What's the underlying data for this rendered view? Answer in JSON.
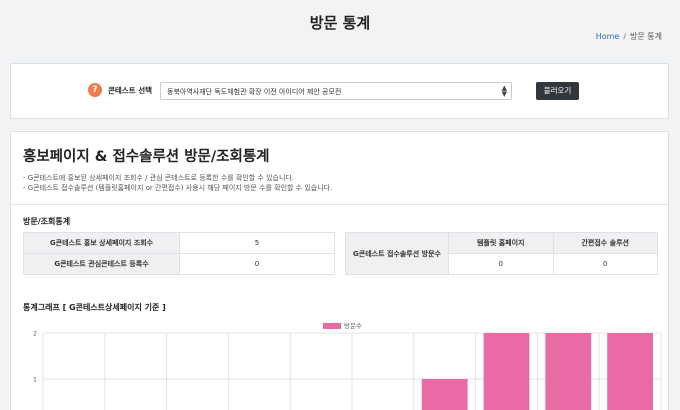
{
  "page": {
    "title": "방문 통계",
    "breadcrumb": {
      "home": "Home",
      "separator": "/",
      "current": "방문 통계"
    }
  },
  "selector": {
    "help_icon": "question-icon",
    "help_glyph": "?",
    "label": "콘테스트 선택",
    "selected_value": "동북아역사재단 독도체험관 확장 이전 아이디어 제안 공모전",
    "load_button": "불러오기",
    "accent_color": "#ef7c4c"
  },
  "main": {
    "title": "홍보페이지 & 접수솔루션 방문/조회통계",
    "descriptions": [
      "- G콘테스트에 홍보된 상세페이지 조회수 / 관심 콘테스트로 등록한 수를 확인할 수 있습니다.",
      "- G콘테스트 접수솔루션 (템플릿홈페이지 or 간편접수) 사용시 해당 페이지 방문 수를 확인할 수 있습니다."
    ],
    "stats_section_title": "방문/조회통계",
    "left_table": [
      {
        "label": "G콘테스트 홍보 상세페이지 조회수",
        "value": "5"
      },
      {
        "label": "G콘테스트 관심콘테스트 등록수",
        "value": "0"
      }
    ],
    "right_table": {
      "row_header": "G콘테스트 접수솔루션 방문수",
      "columns": [
        "템플릿 홈페이지",
        "간편접수 솔루션"
      ],
      "values": [
        "0",
        "0"
      ]
    },
    "graph_section_title": "통계그래프 [ G콘테스트상세페이지 기준 ]"
  },
  "chart_data": {
    "type": "bar",
    "series": [
      {
        "name": "방문수",
        "values": [
          0,
          0,
          0,
          0,
          0,
          0,
          1,
          2,
          2,
          2
        ]
      }
    ],
    "y_ticks": [
      1,
      2
    ],
    "ylim": [
      0,
      2
    ],
    "grid": true,
    "legend": "top-center",
    "color": "#ea6aa6"
  }
}
